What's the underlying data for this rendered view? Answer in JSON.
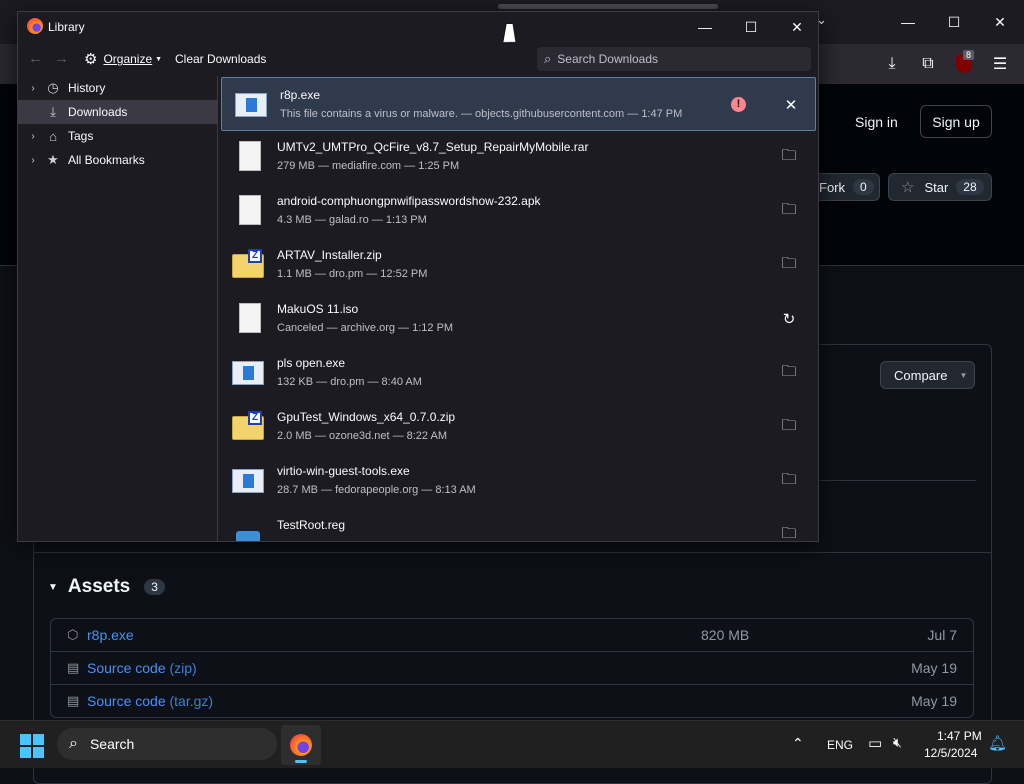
{
  "browser": {
    "window_controls": {
      "minimize": "—",
      "maximize": "☐",
      "close": "✕"
    },
    "toolbar_icons": [
      "download-icon",
      "extensions-icon",
      "ublock-icon",
      "menu-icon"
    ],
    "ublock_badge": "8"
  },
  "github": {
    "sign_in": "Sign in",
    "sign_up": "Sign up",
    "fork_label": "Fork",
    "fork_count": "0",
    "star_label": "Star",
    "star_count": "28",
    "compare_label": "Compare",
    "assets_title": "Assets",
    "assets_count": "3",
    "assets": [
      {
        "name": "r8p.exe",
        "size": "820 MB",
        "date": "Jul 7"
      },
      {
        "name": "Source code",
        "suffix": "(zip)",
        "size": "",
        "date": "May 19"
      },
      {
        "name": "Source code",
        "suffix": "(tar.gz)",
        "size": "",
        "date": "May 19"
      }
    ]
  },
  "library": {
    "title": "Library",
    "organize_label": "Organize",
    "clear_downloads_label": "Clear Downloads",
    "search_placeholder": "Search Downloads",
    "sidebar": [
      {
        "label": "History",
        "icon": "clock-icon",
        "expandable": true,
        "selected": false
      },
      {
        "label": "Downloads",
        "icon": "download-icon",
        "expandable": false,
        "selected": true
      },
      {
        "label": "Tags",
        "icon": "tag-icon",
        "expandable": true,
        "selected": false
      },
      {
        "label": "All Bookmarks",
        "icon": "star-icon",
        "expandable": true,
        "selected": false
      }
    ],
    "downloads": [
      {
        "name": "r8p.exe",
        "meta": "This file contains a virus or malware. — objects.githubusercontent.com — 1:47 PM",
        "type": "exe",
        "action": "close-icon",
        "warning": true
      },
      {
        "name": "UMTv2_UMTPro_QcFire_v8.7_Setup_RepairMyMobile.rar",
        "meta": "279 MB — mediafire.com — 1:25 PM",
        "type": "doc",
        "action": "folder-icon"
      },
      {
        "name": "android-comphuongpnwifipasswordshow-232.apk",
        "meta": "4.3 MB — galad.ro — 1:13 PM",
        "type": "doc",
        "action": "folder-icon"
      },
      {
        "name": "ARTAV_Installer.zip",
        "meta": "1.1 MB — dro.pm — 12:52 PM",
        "type": "zip",
        "action": "folder-icon"
      },
      {
        "name": "MakuOS 11.iso",
        "meta": "Canceled — archive.org — 1:12 PM",
        "type": "doc",
        "action": "retry-icon"
      },
      {
        "name": "pls open.exe",
        "meta": "132 KB — dro.pm — 8:40 AM",
        "type": "exe",
        "action": "folder-icon"
      },
      {
        "name": "GpuTest_Windows_x64_0.7.0.zip",
        "meta": "2.0 MB — ozone3d.net — 8:22 AM",
        "type": "zip",
        "action": "folder-icon"
      },
      {
        "name": "virtio-win-guest-tools.exe",
        "meta": "28.7 MB — fedorapeople.org — 8:13 AM",
        "type": "exe",
        "action": "folder-icon"
      },
      {
        "name": "TestRoot.reg",
        "meta": "",
        "type": "reg",
        "action": "folder-icon"
      }
    ]
  },
  "taskbar": {
    "search_label": "Search",
    "language": "ENG",
    "time": "1:47 PM",
    "date": "12/5/2024"
  },
  "colors": {
    "warning_red": "#ff848b",
    "link_blue": "#4493f8",
    "selection_bg": "#2f3a4d"
  }
}
